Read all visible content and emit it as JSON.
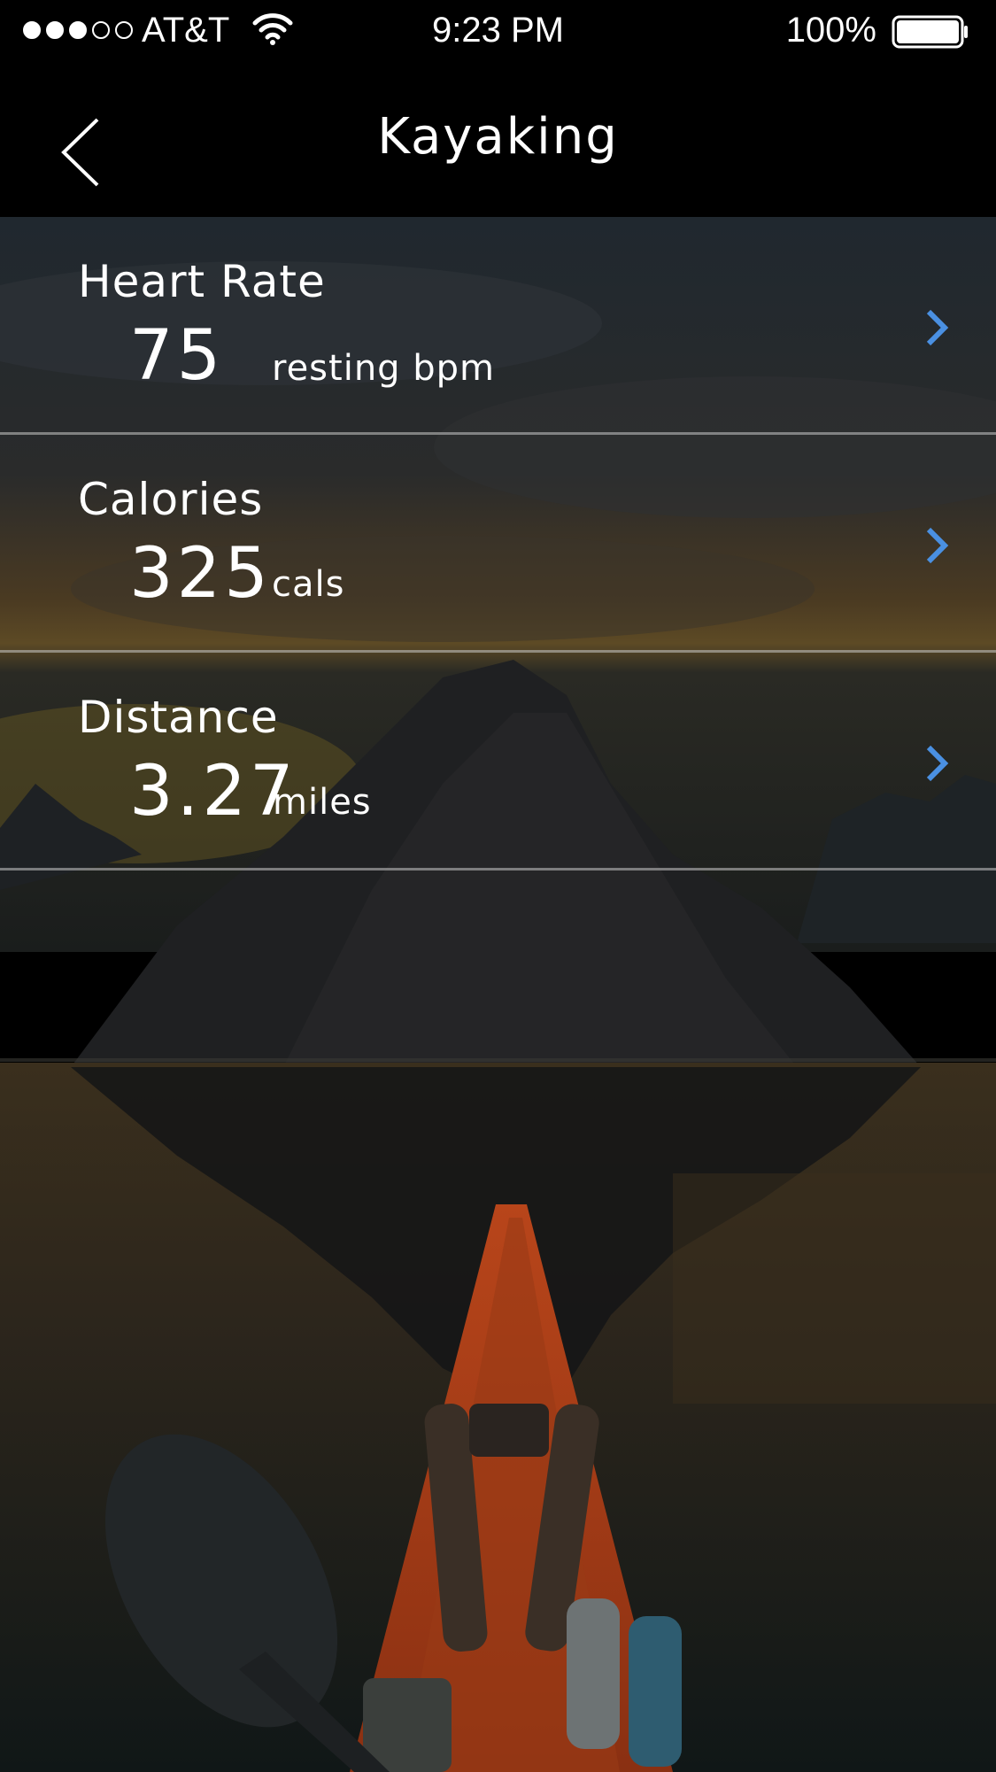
{
  "status_bar": {
    "carrier": "AT&T",
    "time": "9:23 PM",
    "battery_percent": "100%",
    "signal_bars_filled": 3,
    "signal_bars_total": 5
  },
  "nav": {
    "title": "Kayaking",
    "back_icon": "chevron-left-icon"
  },
  "metrics": [
    {
      "label": "Heart Rate",
      "value": "75",
      "unit": "resting bpm"
    },
    {
      "label": "Calories",
      "value": "325",
      "unit": "cals"
    },
    {
      "label": "Distance",
      "value": "3.27",
      "unit": "miles"
    }
  ],
  "colors": {
    "accent": "#4a90e2",
    "kayak": "#d9541e",
    "background": "#000000"
  }
}
